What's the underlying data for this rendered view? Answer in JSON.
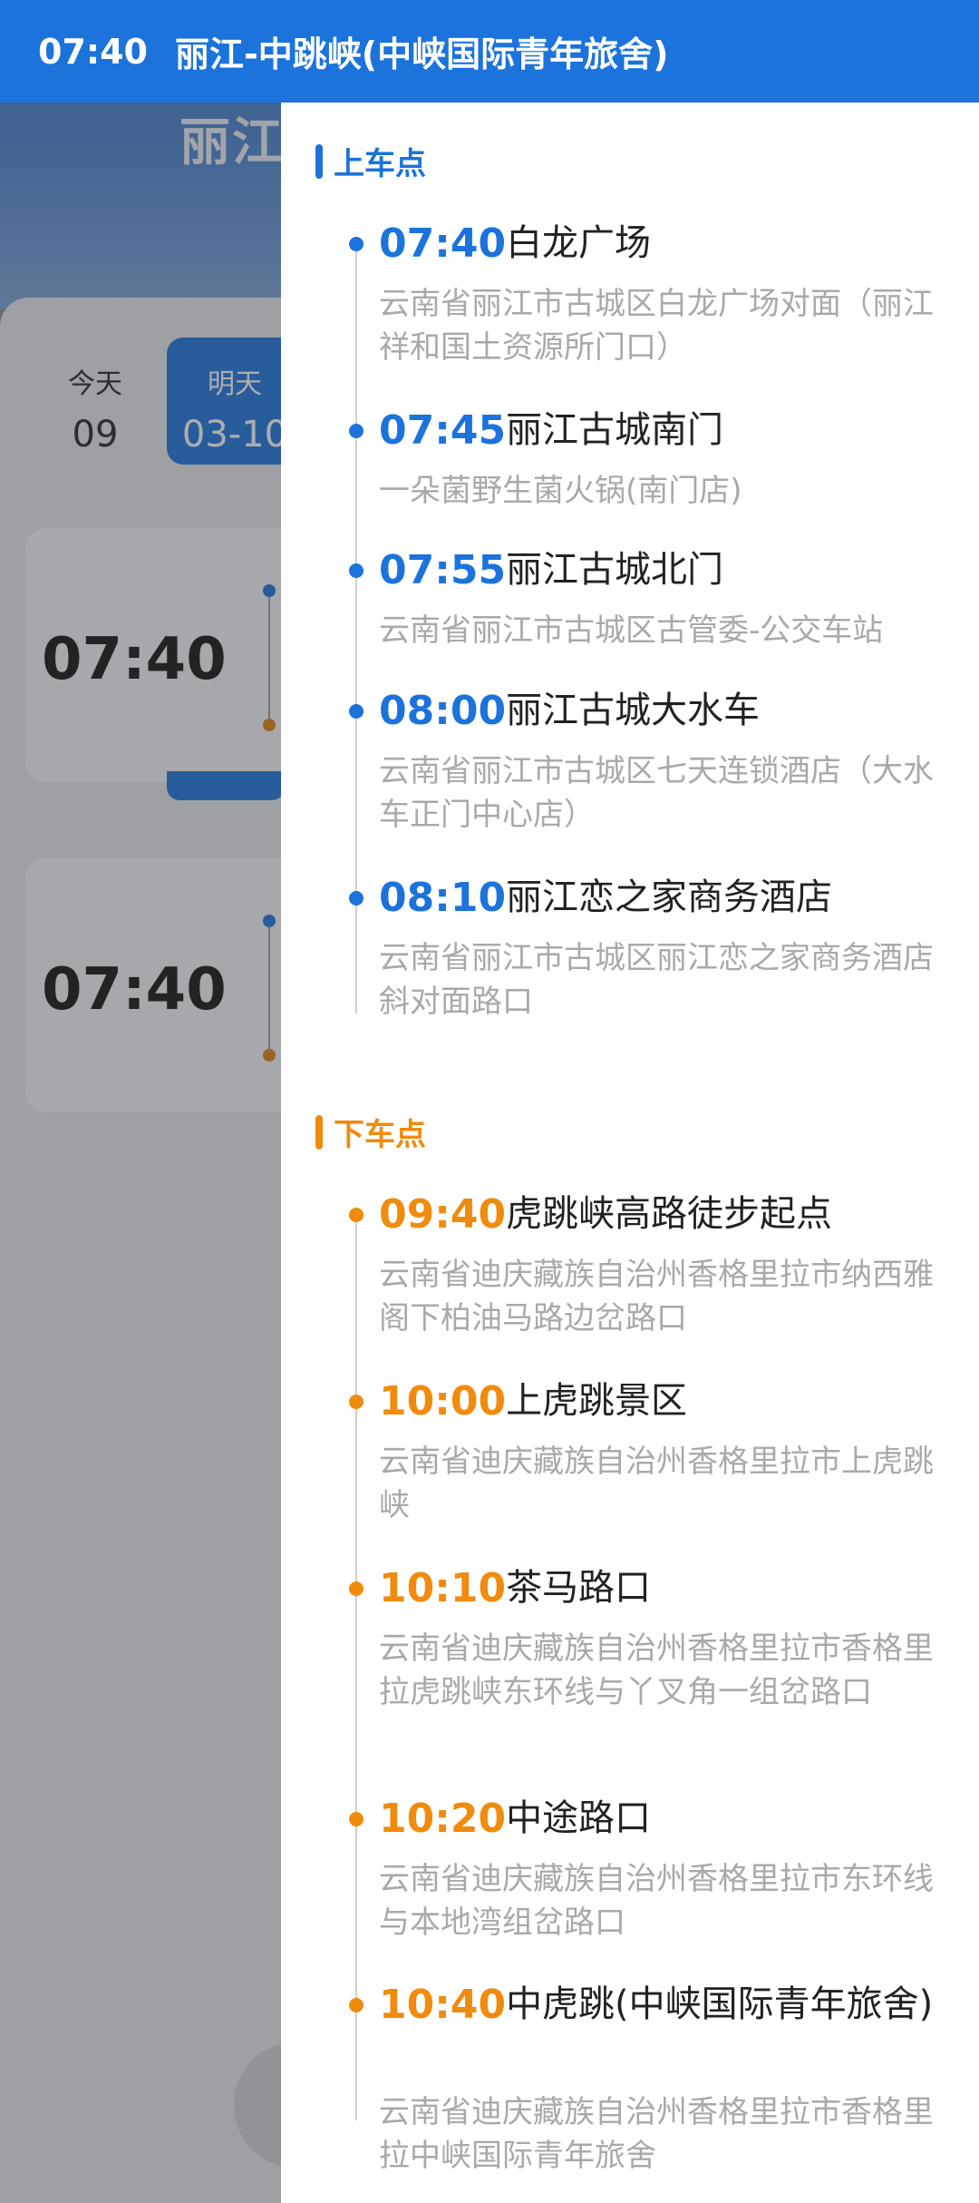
{
  "topbar": {
    "time": "07:40",
    "route": "丽江-中跳峡(中峡国际青年旅舍)"
  },
  "background": {
    "hero_title": "丽江",
    "dates": [
      {
        "label": "今天",
        "value": "09"
      },
      {
        "label": "明天",
        "value": "03-10"
      }
    ],
    "trips": [
      {
        "time": "07:40"
      },
      {
        "time": "07:40"
      }
    ]
  },
  "boarding": {
    "title": "上车点",
    "stops": [
      {
        "time": "07:40",
        "name": "白龙广场",
        "address": "云南省丽江市古城区白龙广场对面（丽江祥和国土资源所门口）"
      },
      {
        "time": "07:45",
        "name": "丽江古城南门",
        "address": "一朵菌野生菌火锅(南门店)"
      },
      {
        "time": "07:55",
        "name": "丽江古城北门",
        "address": "云南省丽江市古城区古管委-公交车站"
      },
      {
        "time": "08:00",
        "name": "丽江古城大水车",
        "address": "云南省丽江市古城区七天连锁酒店（大水车正门中心店）"
      },
      {
        "time": "08:10",
        "name": "丽江恋之家商务酒店",
        "address": "云南省丽江市古城区丽江恋之家商务酒店斜对面路口"
      }
    ]
  },
  "alighting": {
    "title": "下车点",
    "stops": [
      {
        "time": "09:40",
        "name": "虎跳峡高路徒步起点",
        "address": "云南省迪庆藏族自治州香格里拉市纳西雅阁下柏油马路边岔路口"
      },
      {
        "time": "10:00",
        "name": "上虎跳景区",
        "address": "云南省迪庆藏族自治州香格里拉市上虎跳峡"
      },
      {
        "time": "10:10",
        "name": "茶马路口",
        "address": "云南省迪庆藏族自治州香格里拉市香格里拉虎跳峡东环线与丫叉角一组岔路口"
      },
      {
        "time": "10:20",
        "name": "中途路口",
        "address": "云南省迪庆藏族自治州香格里拉市东环线与本地湾组岔路口"
      },
      {
        "time": "10:40",
        "name": "中虎跳(中峡国际青年旅舍)",
        "address": "云南省迪庆藏族自治州香格里拉市香格里拉中峡国际青年旅舍"
      }
    ]
  },
  "colors": {
    "primary": "#1b73db",
    "accent": "#f08b0d",
    "address_gray": "#a9a9a9"
  }
}
